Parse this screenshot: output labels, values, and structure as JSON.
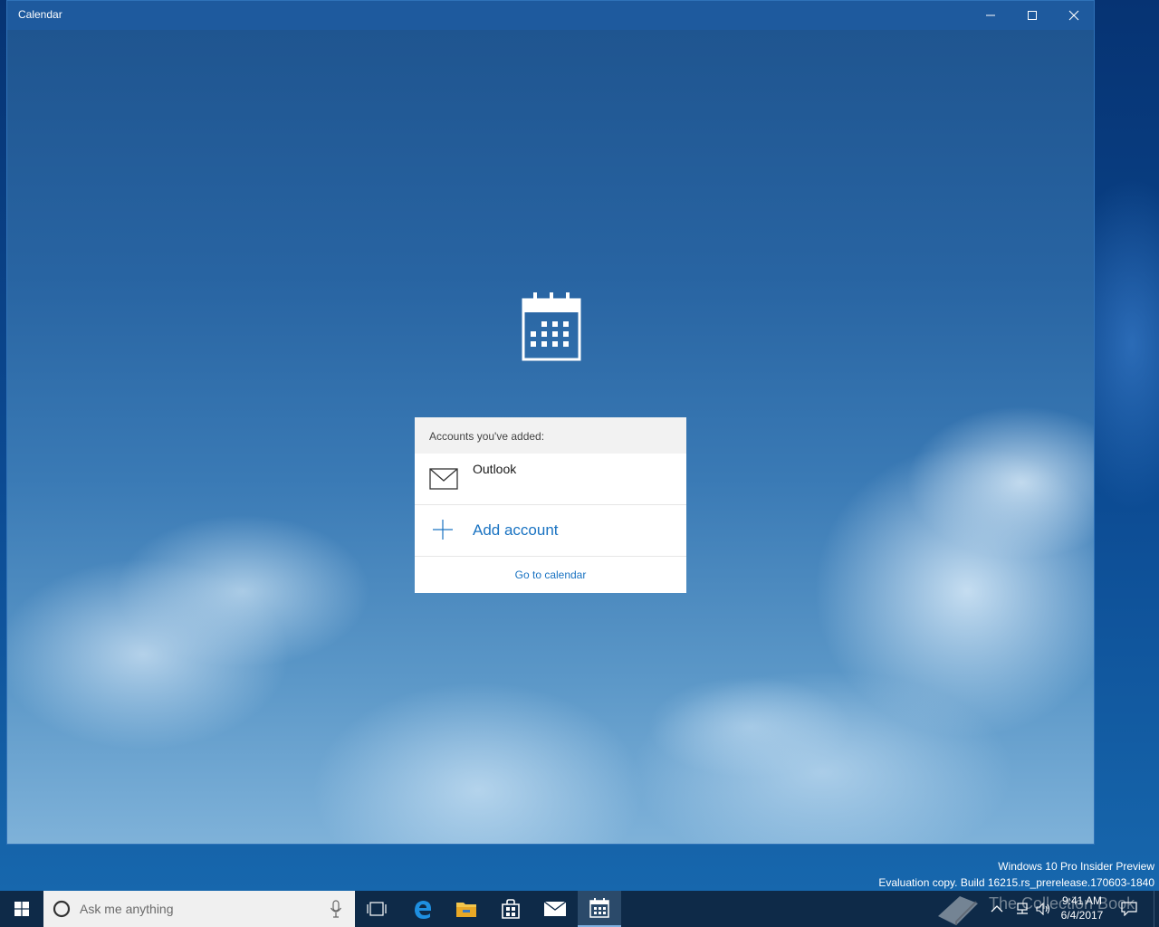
{
  "window": {
    "title": "Calendar",
    "controls": [
      "minimize-icon",
      "maximize-icon",
      "close-icon"
    ]
  },
  "app_icon": "calendar-icon",
  "accounts_card": {
    "header": "Accounts you've added:",
    "accounts": [
      {
        "name": "Outlook",
        "icon": "mail-icon"
      }
    ],
    "add_account_label": "Add account",
    "go_to_calendar_label": "Go to calendar"
  },
  "desktop": {
    "watermark_line1": "Windows 10 Pro Insider Preview",
    "watermark_line2": "Evaluation copy. Build 16215.rs_prerelease.170603-1840"
  },
  "taskbar": {
    "search_placeholder": "Ask me anything",
    "pinned_apps": [
      "task-view-icon",
      "edge-icon",
      "file-explorer-icon",
      "store-icon",
      "mail-icon",
      "calendar-icon"
    ],
    "active_app": "calendar-icon",
    "clock_time": "9:41 AM",
    "clock_date": "6/4/2017",
    "overlay_logo_text": "The Collection Book"
  },
  "colors": {
    "accent": "#1a73c2",
    "titlebar": "#1e5a9e",
    "taskbar": "#0e2a48"
  }
}
